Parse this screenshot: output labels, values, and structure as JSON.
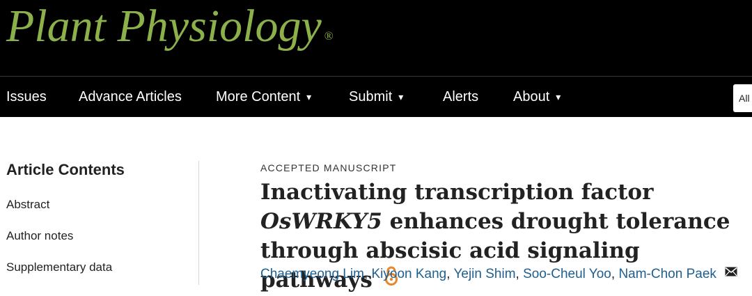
{
  "site": {
    "logo_text": "Plant Physiology",
    "logo_mark": "®",
    "logo_color": "#8db14a"
  },
  "nav": {
    "items": [
      {
        "label": "Issues",
        "has_dropdown": false
      },
      {
        "label": "Advance Articles",
        "has_dropdown": false
      },
      {
        "label": "More Content",
        "has_dropdown": true
      },
      {
        "label": "Submit",
        "has_dropdown": true
      },
      {
        "label": "Alerts",
        "has_dropdown": false
      },
      {
        "label": "About",
        "has_dropdown": true
      }
    ],
    "caret_glyph": "▾",
    "search_scope": "All"
  },
  "sidebar": {
    "title": "Article Contents",
    "items": [
      "Abstract",
      "Author notes",
      "Supplementary data"
    ]
  },
  "article": {
    "kicker": "ACCEPTED MANUSCRIPT",
    "title_before": "Inactivating transcription factor ",
    "title_italic": "OsWRKY5",
    "title_after": " enhances drought tolerance through abscisic acid signaling pathways",
    "open_access_icon": "open-access-icon",
    "open_access_color": "#e8862b",
    "authors": [
      "Chaemyeong Lim",
      "Kiyoon Kang",
      "Yejin Shim",
      "Soo-Cheul Yoo",
      "Nam-Chon Paek"
    ],
    "author_separator": ",",
    "author_link_color": "#1d5f8f",
    "contact_icon": "envelope-icon"
  }
}
